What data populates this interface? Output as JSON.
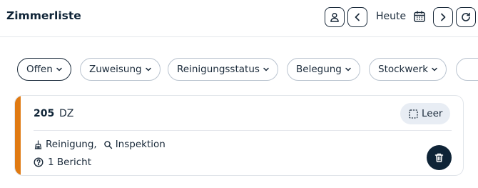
{
  "header": {
    "title": "Zimmerliste",
    "today_label": "Heute"
  },
  "filters": [
    {
      "label": "Offen",
      "active": true
    },
    {
      "label": "Zuweisung",
      "active": false
    },
    {
      "label": "Reinigungsstatus",
      "active": false
    },
    {
      "label": "Belegung",
      "active": false
    },
    {
      "label": "Stockwerk",
      "active": false
    }
  ],
  "room": {
    "number": "205",
    "type": "DZ",
    "status": "Leer",
    "tasks": [
      "Reinigung,",
      "Inspektion"
    ],
    "reports": "1 Bericht",
    "accent_color": "#e07a12"
  },
  "icons": {
    "user": "user-icon",
    "prev": "chevron-left-icon",
    "calendar": "calendar-icon",
    "next": "chevron-right-icon",
    "refresh": "refresh-icon",
    "vacant": "dashed-square-icon",
    "cleaning": "broom-icon",
    "inspection": "search-icon",
    "report": "help-circle-icon",
    "delete": "trash-icon"
  }
}
